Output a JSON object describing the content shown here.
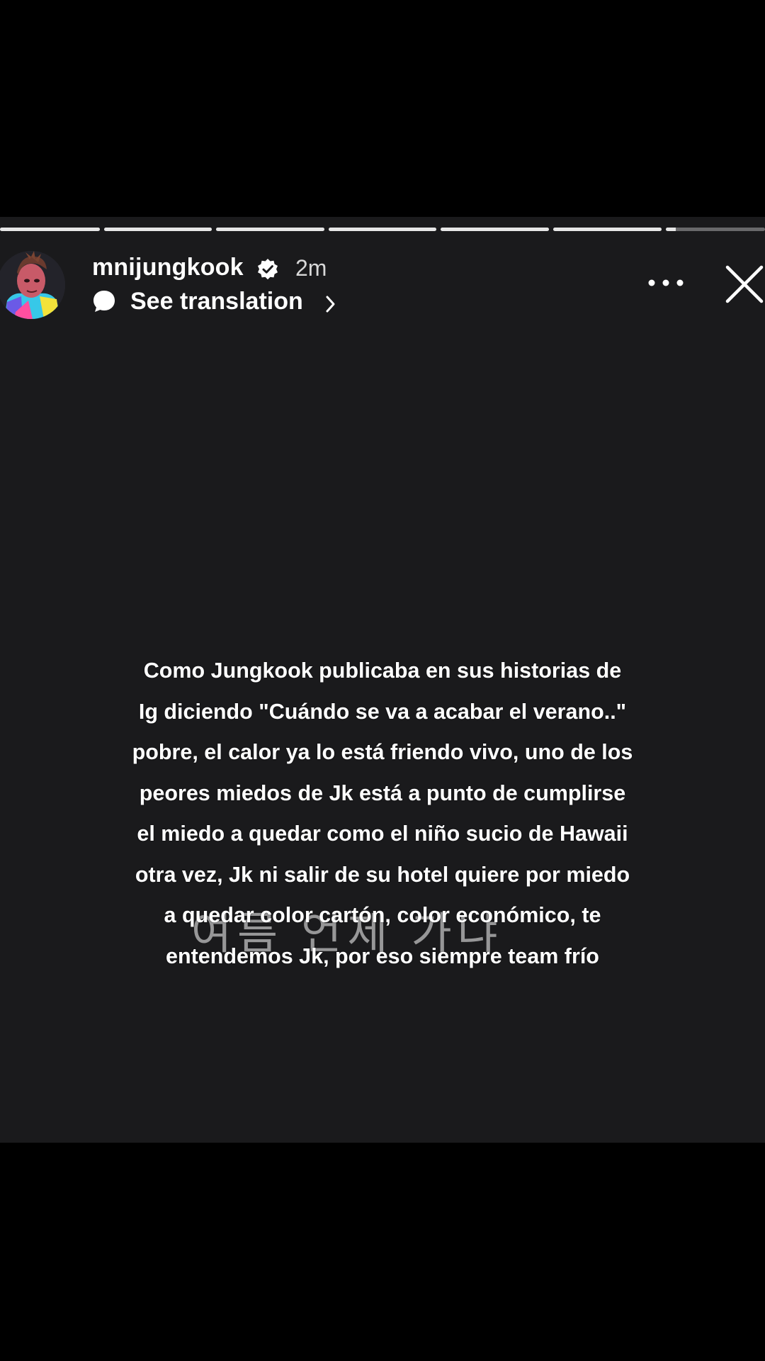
{
  "story": {
    "progress_segments": [
      {
        "fill": 1.0
      },
      {
        "fill": 1.0
      },
      {
        "fill": 1.0
      },
      {
        "fill": 1.0
      },
      {
        "fill": 1.0
      },
      {
        "fill": 1.0
      },
      {
        "fill": 0.1
      }
    ],
    "username": "mnijungkook",
    "timestamp": "2m",
    "translate_label": "See translation",
    "icons": {
      "verified": "verified-badge-icon",
      "translate": "speech-bubble-icon",
      "chevron": "chevron-right-icon",
      "more": "more-dots-icon",
      "close": "close-icon"
    }
  },
  "caption": {
    "lines": [
      "Como Jungkook publicaba en sus historias de",
      "Ig diciendo \"Cuándo se va a acabar el verano..\"",
      "pobre, el calor ya lo está friendo vivo, uno de los",
      "peores miedos de Jk está a punto de cumplirse",
      "el miedo a quedar como el niño sucio de Hawaii",
      "otra vez, Jk ni salir de su hotel quiere por miedo",
      "a quedar color cartón, color económico, te",
      "entendemos Jk, por eso siempre team frío"
    ]
  },
  "background_text": "여름 언제 가냐",
  "colors": {
    "background": "#000000",
    "story_background": "#1a1a1c",
    "text": "#ffffff"
  }
}
